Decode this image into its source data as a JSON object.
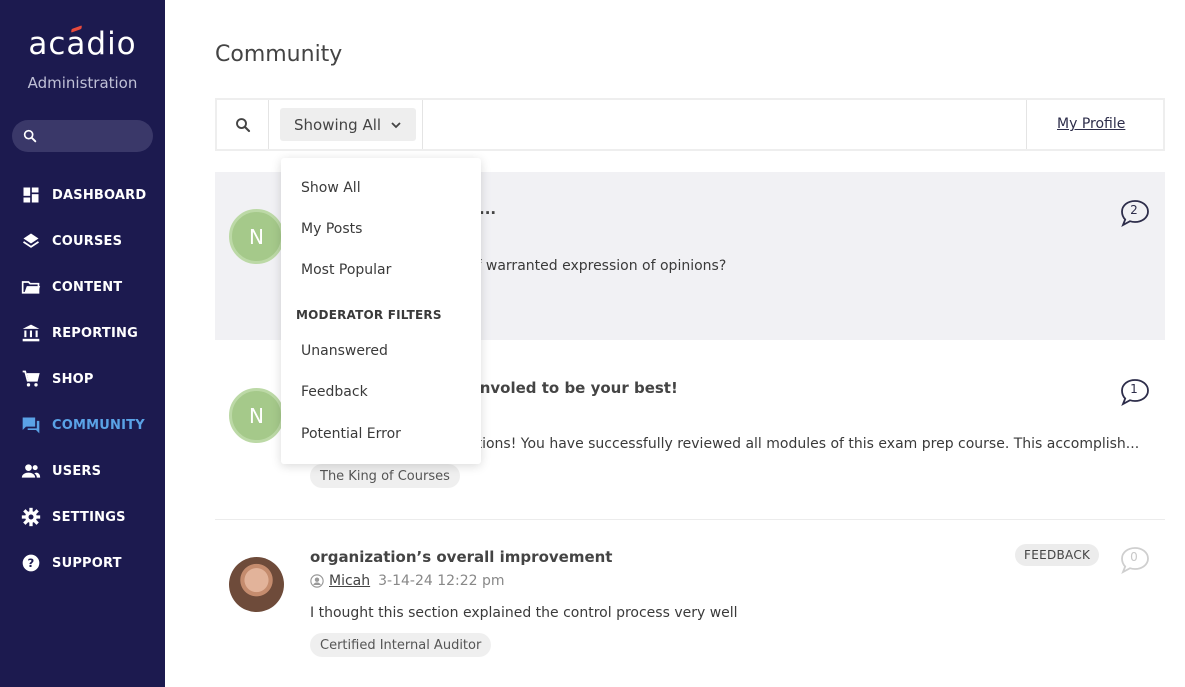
{
  "sidebar": {
    "logo": "acádio",
    "admin_label": "Administration",
    "search_placeholder": "",
    "items": [
      {
        "label": "DASHBOARD",
        "icon": "dashboard-icon",
        "active": false
      },
      {
        "label": "COURSES",
        "icon": "layers-icon",
        "active": false
      },
      {
        "label": "CONTENT",
        "icon": "folder-icon",
        "active": false
      },
      {
        "label": "REPORTING",
        "icon": "bank-icon",
        "active": false
      },
      {
        "label": "SHOP",
        "icon": "cart-icon",
        "active": false
      },
      {
        "label": "COMMUNITY",
        "icon": "chat-icon",
        "active": true
      },
      {
        "label": "USERS",
        "icon": "users-icon",
        "active": false
      },
      {
        "label": "SETTINGS",
        "icon": "gear-icon",
        "active": false
      },
      {
        "label": "SUPPORT",
        "icon": "help-icon",
        "active": false
      }
    ]
  },
  "main": {
    "title": "Community",
    "filter_label": "Showing All",
    "my_profile": "My Profile"
  },
  "dropdown": {
    "items": [
      "Show All",
      "My Posts",
      "Most Popular"
    ],
    "moderator_heading": "MODERATOR FILTERS",
    "moderator_items": [
      "Unanswered",
      "Feedback",
      "Potential Error"
    ]
  },
  "posts": [
    {
      "avatar_initial": "N",
      "title_fragment": "...",
      "body_fragment": "le of warranted expression of opinions?",
      "comment_count": "2"
    },
    {
      "avatar_initial": "N",
      "title_fragment": "et involed to be your best!",
      "body_fragment": "ations! You have successfully reviewed all modules of this exam prep course. This accomplish...",
      "tag": "The King of Courses",
      "comment_count": "1"
    },
    {
      "title": "organization’s overall improvement",
      "author": "Micah",
      "date": "3-14-24 12:22 pm",
      "body": "I thought this section explained the control process very well",
      "tag": "Certified Internal Auditor",
      "badge": "FEEDBACK",
      "comment_count": "0"
    }
  ],
  "colors": {
    "sidebar_bg": "#1c1a4f",
    "active_nav": "#5aa2e6",
    "avatar_green": "#a5c98a",
    "logo_accent": "#e84a3c"
  }
}
